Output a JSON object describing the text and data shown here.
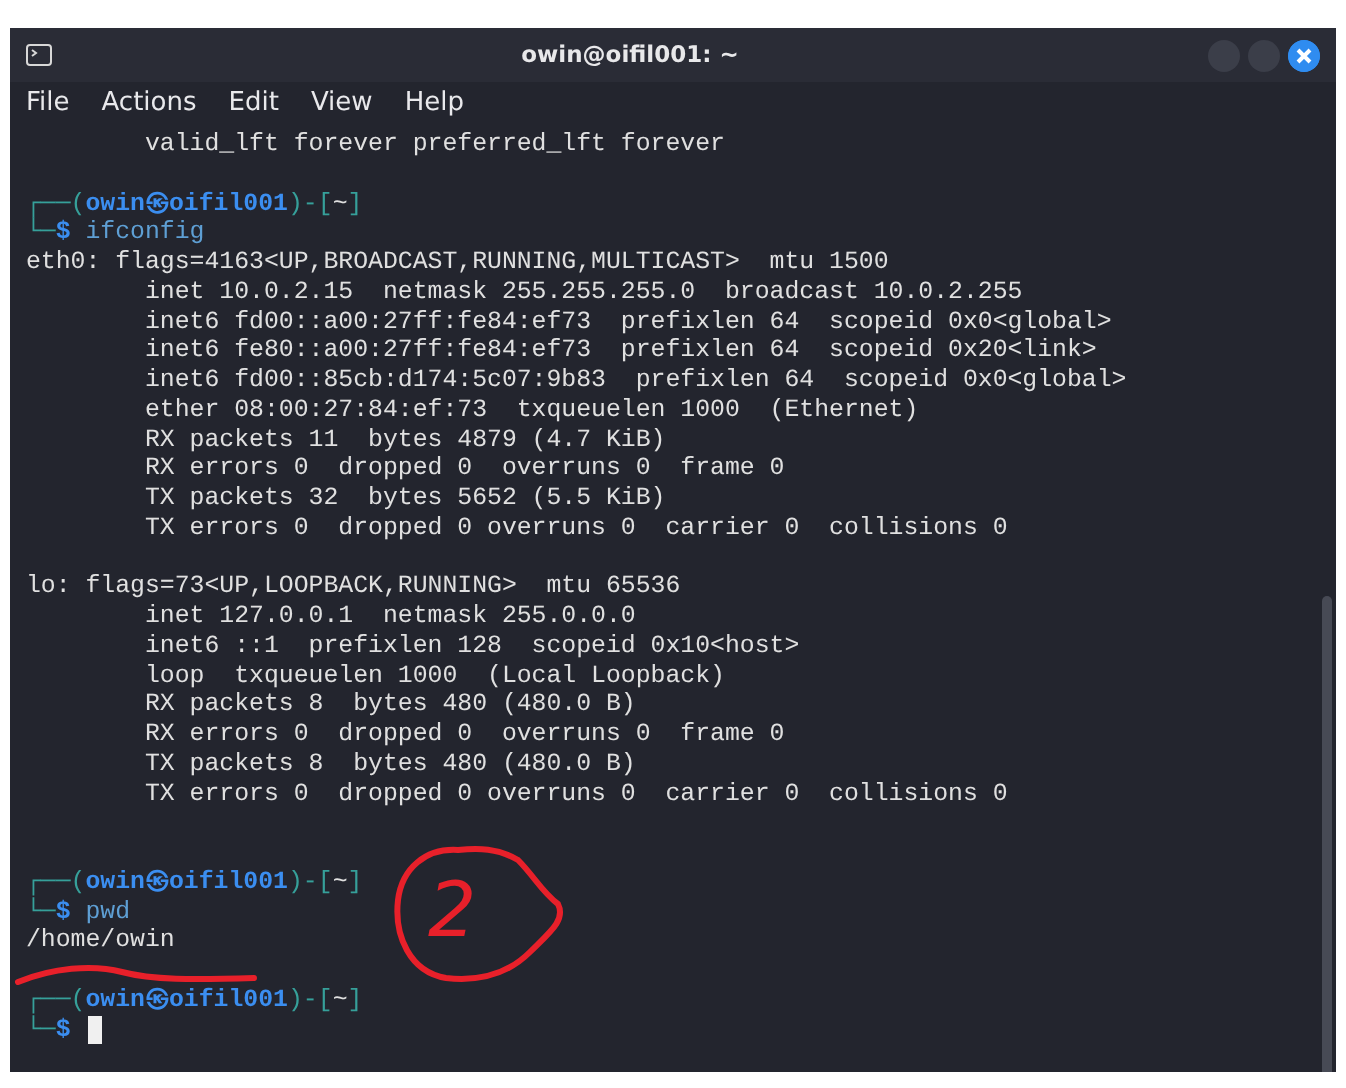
{
  "window": {
    "title": "owin@oifil001: ~"
  },
  "menu": [
    "File",
    "Actions",
    "Edit",
    "View",
    "Help"
  ],
  "terminal": {
    "lines": [
      {
        "kind": "output",
        "text": "        valid_lft forever preferred_lft forever"
      },
      {
        "kind": "blank"
      },
      {
        "kind": "prompt",
        "open": "┌──(",
        "user": "owin",
        "at": "㉿",
        "host": "oifil001",
        "mid": ")-[",
        "dir": "~",
        "close": "]",
        "lead": "└─",
        "symbol": "$",
        "command": "ifconfig",
        "cursor": false
      },
      {
        "kind": "output",
        "text": "eth0: flags=4163<UP,BROADCAST,RUNNING,MULTICAST>  mtu 1500"
      },
      {
        "kind": "output",
        "text": "        inet 10.0.2.15  netmask 255.255.255.0  broadcast 10.0.2.255"
      },
      {
        "kind": "output",
        "text": "        inet6 fd00::a00:27ff:fe84:ef73  prefixlen 64  scopeid 0x0<global>"
      },
      {
        "kind": "output",
        "text": "        inet6 fe80::a00:27ff:fe84:ef73  prefixlen 64  scopeid 0x20<link>"
      },
      {
        "kind": "output",
        "text": "        inet6 fd00::85cb:d174:5c07:9b83  prefixlen 64  scopeid 0x0<global>"
      },
      {
        "kind": "output",
        "text": "        ether 08:00:27:84:ef:73  txqueuelen 1000  (Ethernet)"
      },
      {
        "kind": "output",
        "text": "        RX packets 11  bytes 4879 (4.7 KiB)"
      },
      {
        "kind": "output",
        "text": "        RX errors 0  dropped 0  overruns 0  frame 0"
      },
      {
        "kind": "output",
        "text": "        TX packets 32  bytes 5652 (5.5 KiB)"
      },
      {
        "kind": "output",
        "text": "        TX errors 0  dropped 0 overruns 0  carrier 0  collisions 0"
      },
      {
        "kind": "blank"
      },
      {
        "kind": "output",
        "text": "lo: flags=73<UP,LOOPBACK,RUNNING>  mtu 65536"
      },
      {
        "kind": "output",
        "text": "        inet 127.0.0.1  netmask 255.0.0.0"
      },
      {
        "kind": "output",
        "text": "        inet6 ::1  prefixlen 128  scopeid 0x10<host>"
      },
      {
        "kind": "output",
        "text": "        loop  txqueuelen 1000  (Local Loopback)"
      },
      {
        "kind": "output",
        "text": "        RX packets 8  bytes 480 (480.0 B)"
      },
      {
        "kind": "output",
        "text": "        RX errors 0  dropped 0  overruns 0  frame 0"
      },
      {
        "kind": "output",
        "text": "        TX packets 8  bytes 480 (480.0 B)"
      },
      {
        "kind": "output",
        "text": "        TX errors 0  dropped 0 overruns 0  carrier 0  collisions 0"
      },
      {
        "kind": "blank"
      },
      {
        "kind": "blank"
      },
      {
        "kind": "prompt",
        "open": "┌──(",
        "user": "owin",
        "at": "㉿",
        "host": "oifil001",
        "mid": ")-[",
        "dir": "~",
        "close": "]",
        "lead": "└─",
        "symbol": "$",
        "command": "pwd",
        "cursor": false
      },
      {
        "kind": "output",
        "text": "/home/owin"
      },
      {
        "kind": "blank"
      },
      {
        "kind": "prompt",
        "open": "┌──(",
        "user": "owin",
        "at": "㉿",
        "host": "oifil001",
        "mid": ")-[",
        "dir": "~",
        "close": "]",
        "lead": "└─",
        "symbol": "$",
        "cursor": true
      }
    ]
  },
  "annotations": {
    "circled_text": "2"
  }
}
